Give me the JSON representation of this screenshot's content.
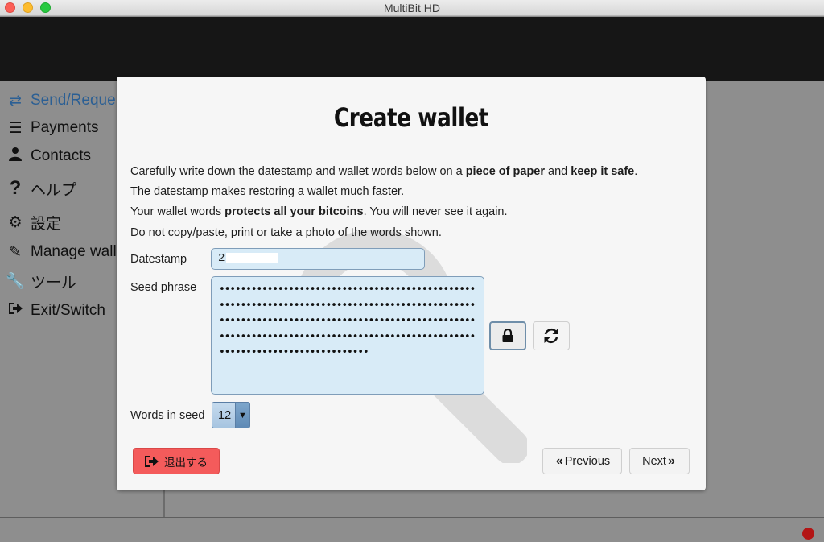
{
  "window": {
    "title": "MultiBit HD"
  },
  "sidebar": {
    "items": [
      {
        "label": "Send/Reque",
        "icon": "arrows-swap-icon",
        "active": true
      },
      {
        "label": "Payments",
        "icon": "list-icon"
      },
      {
        "label": "Contacts",
        "icon": "user-icon"
      },
      {
        "label": "ヘルプ",
        "icon": "question-icon"
      },
      {
        "label": "設定",
        "icon": "gears-icon"
      },
      {
        "label": "Manage wall",
        "icon": "edit-icon"
      },
      {
        "label": "ツール",
        "icon": "wrench-icon"
      },
      {
        "label": "Exit/Switch",
        "icon": "sign-out-icon"
      }
    ]
  },
  "modal": {
    "title": "Create wallet",
    "paragraphs": {
      "p1_a": "Carefully write down the datestamp and wallet words below on a ",
      "p1_b": "piece of paper",
      "p1_c": " and ",
      "p1_d": "keep it safe",
      "p1_e": ".",
      "p2": "The datestamp makes restoring a wallet much faster.",
      "p3_a": "Your wallet words ",
      "p3_b": "protects all your bitcoins",
      "p3_c": ". You will never see it again.",
      "p4": "Do not copy/paste, print or take a photo of the words shown."
    },
    "datestamp": {
      "label": "Datestamp",
      "value": "2"
    },
    "seed": {
      "label": "Seed phrase",
      "masked": "••••••••••••••••••••••••••••••••••••••••••••••••••••••••••••••••••••••••••••••••••••••••••••••••••••••••••••••••••••••••••••••••••••••••••••••••••••••••••••••••••••••••••••••••••••••••••••••••••••••••••••••••••••••••••••"
    },
    "words_in_seed": {
      "label": "Words in seed",
      "value": "12"
    },
    "buttons": {
      "exit": "退出する",
      "previous": "Previous",
      "next": "Next"
    }
  },
  "colors": {
    "accent": "#2b5f94",
    "exit_button": "#f45b5b",
    "input_bg": "#d8ebf7",
    "status_dot": "#b31515"
  }
}
